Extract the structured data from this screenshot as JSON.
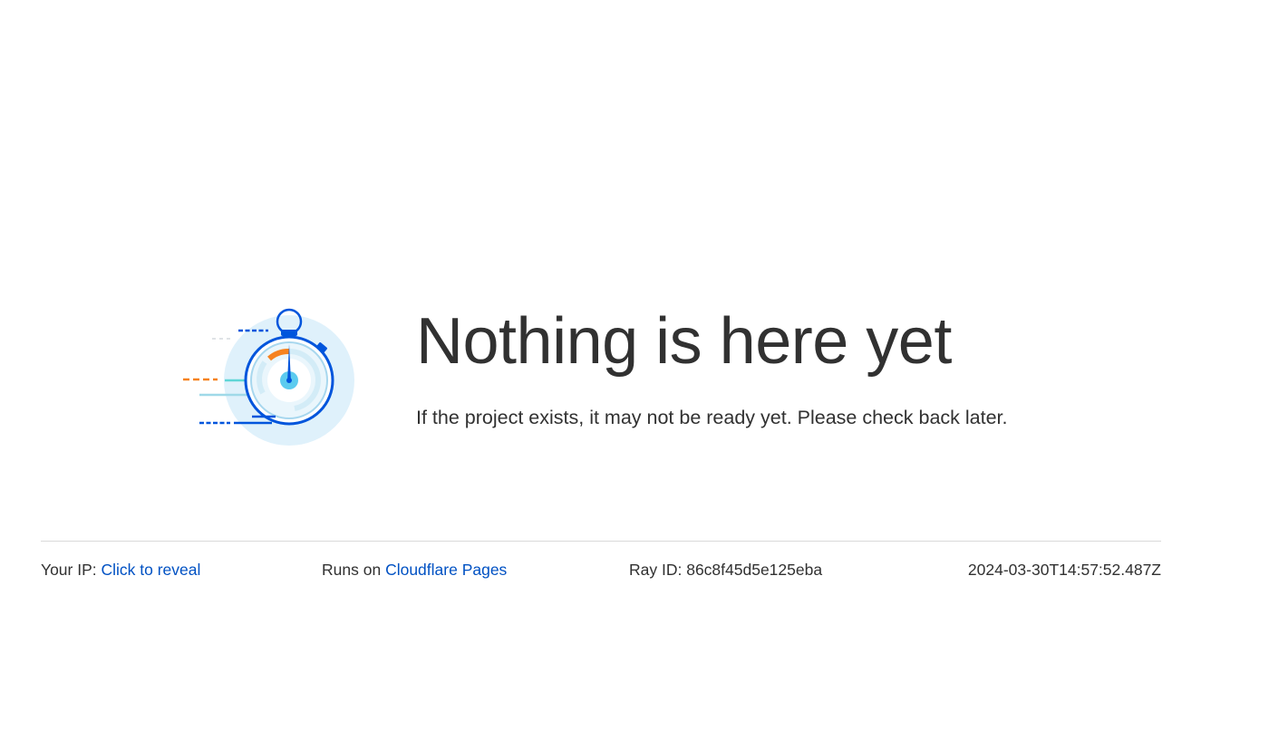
{
  "hero": {
    "title": "Nothing is here yet",
    "message": "If the project exists, it may not be ready yet. Please check back later.",
    "illustration_icon": "stopwatch-icon"
  },
  "footer": {
    "ip_label": "Your IP:",
    "ip_link": "Click to reveal",
    "runs_label": "Runs on",
    "runs_link": "Cloudflare Pages",
    "ray_id": "Ray ID: 86c8f45d5e125eba",
    "timestamp": "2024-03-30T14:57:52.487Z"
  },
  "colors": {
    "text": "#313131",
    "link": "#0051c3",
    "accent_blue": "#0055dc",
    "light_blue": "#dff1fb",
    "orange": "#f6821f",
    "divider": "#d9d9d9"
  }
}
